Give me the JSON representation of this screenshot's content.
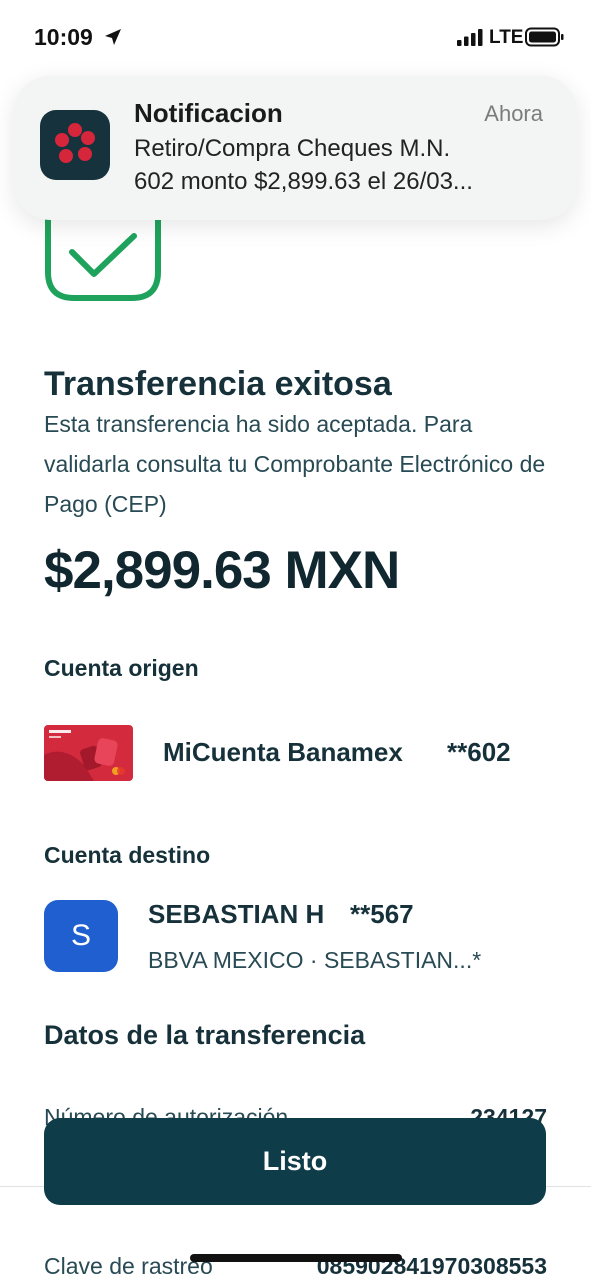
{
  "status_bar": {
    "time": "10:09",
    "network": "LTE",
    "icons": [
      "location-arrow-icon",
      "signal-bars-icon",
      "battery-icon"
    ]
  },
  "notification": {
    "app_icon": "banamex-logo-icon",
    "title": "Notificacion",
    "time": "Ahora",
    "body_line1": "Retiro/Compra Cheques M.N.",
    "body_line2": "602 monto $2,899.63 el 26/03..."
  },
  "result": {
    "icon": "checkmark-icon",
    "title": "Transferencia exitosa",
    "description": "Esta transferencia ha sido aceptada. Para validarla consulta tu Comprobante Electrónico de Pago (CEP)",
    "amount": "$2,899.63 MXN"
  },
  "origin": {
    "label": "Cuenta origen",
    "account_name": "MiCuenta Banamex",
    "account_number": "**602"
  },
  "destination": {
    "label": "Cuenta destino",
    "avatar_letter": "S",
    "name": "SEBASTIAN H",
    "account_number": "**567",
    "bank": "BBVA MEXICO · SEBASTIAN...*"
  },
  "transfer_data": {
    "heading": "Datos de la transferencia",
    "rows": [
      {
        "label": "Número de autorización",
        "value": "234127"
      },
      {
        "label": "Clave de rastreo",
        "value": "085902841970308553"
      }
    ]
  },
  "actions": {
    "done_label": "Listo"
  },
  "colors": {
    "primary_button": "#0e3c49",
    "success_green": "#1fa35c",
    "avatar_blue": "#1f5fcf",
    "text_dark": "#16313a",
    "banamex_red": "#d6263b"
  }
}
